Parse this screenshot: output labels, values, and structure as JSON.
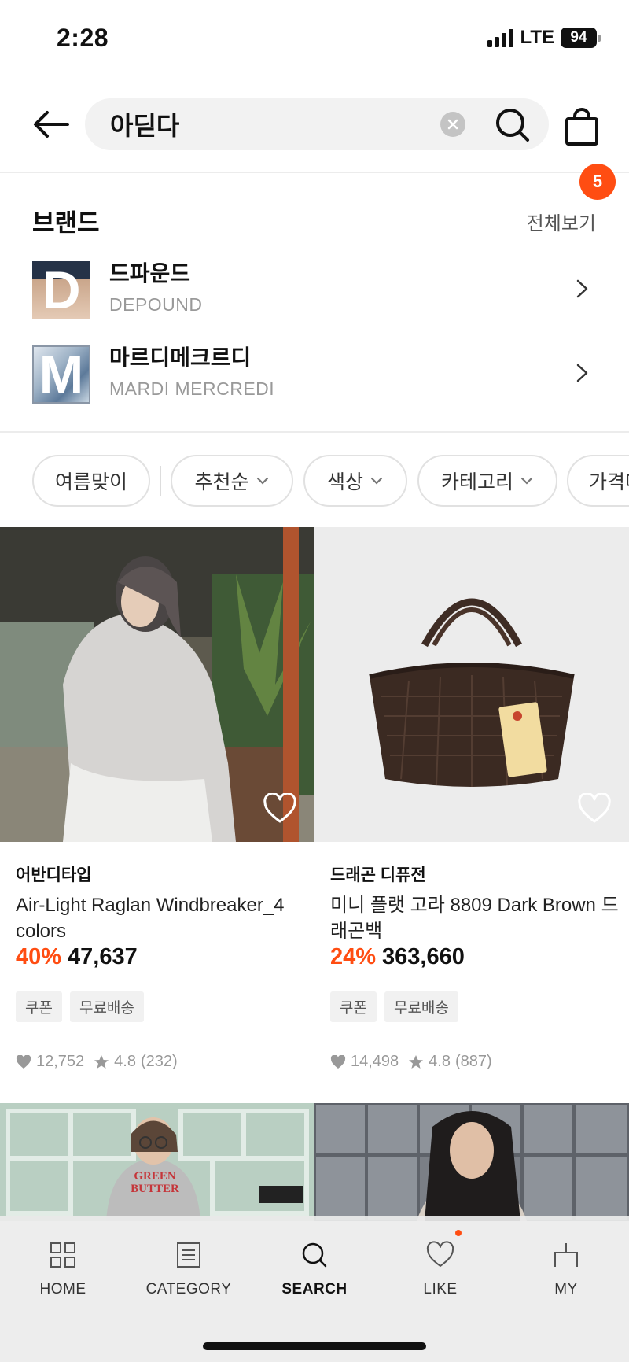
{
  "status_bar": {
    "time": "2:28",
    "network": "LTE",
    "battery": "94"
  },
  "search": {
    "query": "아딛다",
    "cart_count": "5"
  },
  "brands": {
    "title": "브랜드",
    "see_all": "전체보기",
    "items": [
      {
        "name_ko": "드파운드",
        "name_en": "DEPOUND",
        "logo_letter": "D"
      },
      {
        "name_ko": "마르디메크르디",
        "name_en": "MARDI MERCREDI",
        "logo_letter": "M"
      }
    ]
  },
  "filters": {
    "chips": [
      {
        "label": "여름맞이",
        "has_dropdown": false
      },
      {
        "label": "추천순",
        "has_dropdown": true
      },
      {
        "label": "색상",
        "has_dropdown": true
      },
      {
        "label": "카테고리",
        "has_dropdown": true
      },
      {
        "label": "가격대",
        "has_dropdown": false
      }
    ]
  },
  "products": [
    {
      "brand": "어반디타입",
      "name": "Air-Light Raglan Windbreaker_4 colors",
      "discount": "40%",
      "price": "47,637",
      "tags": [
        "쿠폰",
        "무료배송"
      ],
      "likes": "12,752",
      "rating": "4.8",
      "reviews": "(232)"
    },
    {
      "brand": "드래곤 디퓨전",
      "name": "미니 플랫 고라 8809 Dark Brown 드래곤백",
      "discount": "24%",
      "price": "363,660",
      "tags": [
        "쿠폰",
        "무료배송"
      ],
      "likes": "14,498",
      "rating": "4.8",
      "reviews": "(887)"
    }
  ],
  "product_images_row2": [
    {
      "print": "GREEN BUTTER"
    }
  ],
  "nav": {
    "items": [
      {
        "label": "HOME",
        "icon": "grid-icon"
      },
      {
        "label": "CATEGORY",
        "icon": "list-icon"
      },
      {
        "label": "SEARCH",
        "icon": "search-icon",
        "active": true
      },
      {
        "label": "LIKE",
        "icon": "heart-icon"
      },
      {
        "label": "MY",
        "icon": "user-icon"
      }
    ]
  },
  "colors": {
    "accent": "#ff4d12",
    "chip_border": "#e1e1e1",
    "muted_text": "#999999"
  }
}
